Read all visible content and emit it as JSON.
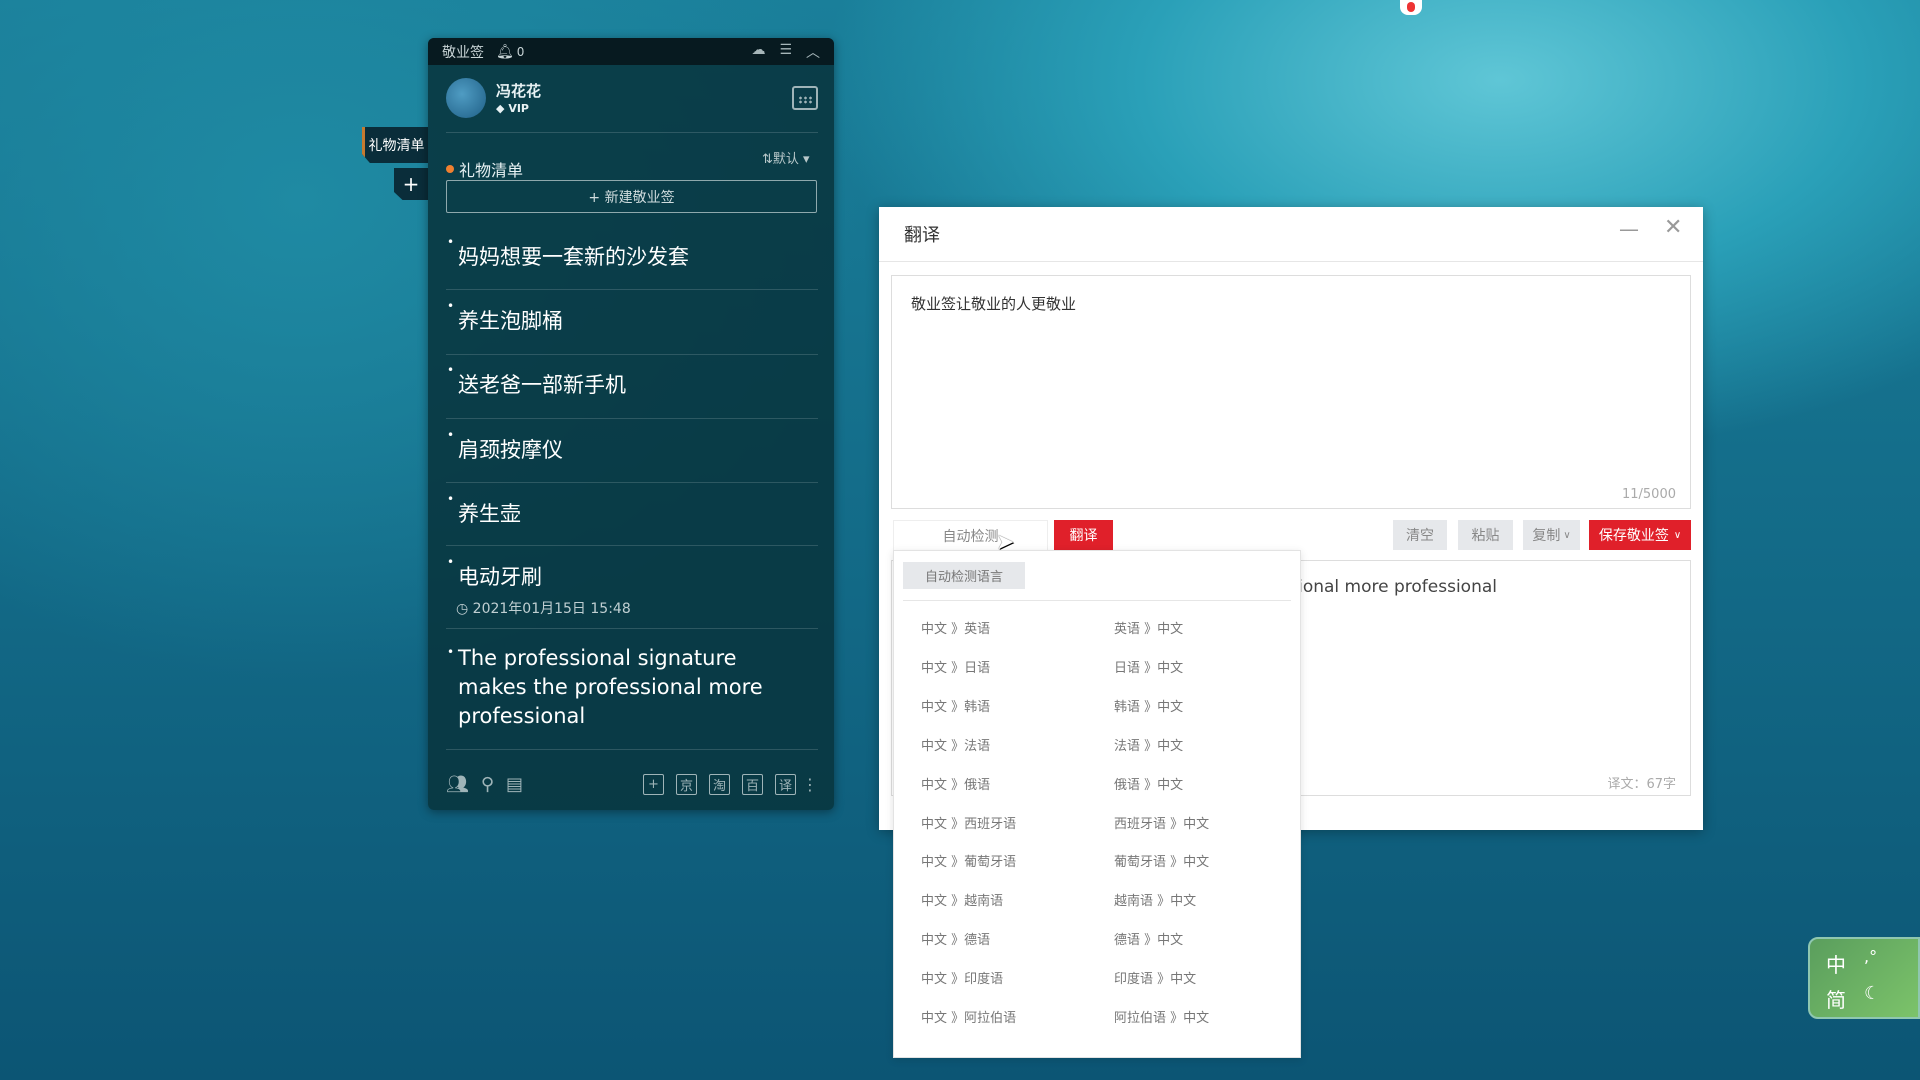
{
  "sticky": {
    "app_title": "敬业签",
    "notification_count": "0",
    "user": {
      "name": "冯花花",
      "badge": "VIP"
    },
    "list_title": "礼物清单",
    "sort_label": "⇅默认",
    "new_button": "+ 新建敬业签",
    "side_tab": "礼物清单",
    "side_add": "+",
    "items": [
      {
        "text": "妈妈想要一套新的沙发套"
      },
      {
        "text": "养生泡脚桶"
      },
      {
        "text": "送老爸一部新手机"
      },
      {
        "text": "肩颈按摩仪"
      },
      {
        "text": "养生壶"
      },
      {
        "text": "电动牙刷",
        "date": "2021年01月15日 15:48"
      },
      {
        "text": "The professional signature makes the professional more professional"
      }
    ],
    "footer_buttons": [
      "+",
      "京",
      "淘",
      "百",
      "译"
    ]
  },
  "translate": {
    "title": "翻译",
    "input_text": "敬业签让敬业的人更敬业",
    "input_count": "11/5000",
    "source_lang": "自动检测",
    "translate_button": "翻译",
    "clear_button": "清空",
    "paste_button": "粘贴",
    "copy_button": "复制",
    "save_button": "保存敬业签",
    "output_text": "The professional signature makes the professional more professional",
    "output_count": "译文：67字",
    "accent_color": "#e0202a"
  },
  "dropdown": {
    "auto_detect": "自动检测语言",
    "pairs": [
      [
        "中文 》英语",
        "英语 》中文"
      ],
      [
        "中文 》日语",
        "日语 》中文"
      ],
      [
        "中文 》韩语",
        "韩语 》中文"
      ],
      [
        "中文 》法语",
        "法语 》中文"
      ],
      [
        "中文 》俄语",
        "俄语 》中文"
      ],
      [
        "中文 》西班牙语",
        "西班牙语 》中文"
      ],
      [
        "中文 》葡萄牙语",
        "葡萄牙语 》中文"
      ],
      [
        "中文 》越南语",
        "越南语 》中文"
      ],
      [
        "中文 》德语",
        "德语 》中文"
      ],
      [
        "中文 》印度语",
        "印度语 》中文"
      ],
      [
        "中文 》阿拉伯语",
        "阿拉伯语 》中文"
      ]
    ]
  },
  "ime": {
    "mode": "中",
    "punct": ",°",
    "charset": "简"
  }
}
